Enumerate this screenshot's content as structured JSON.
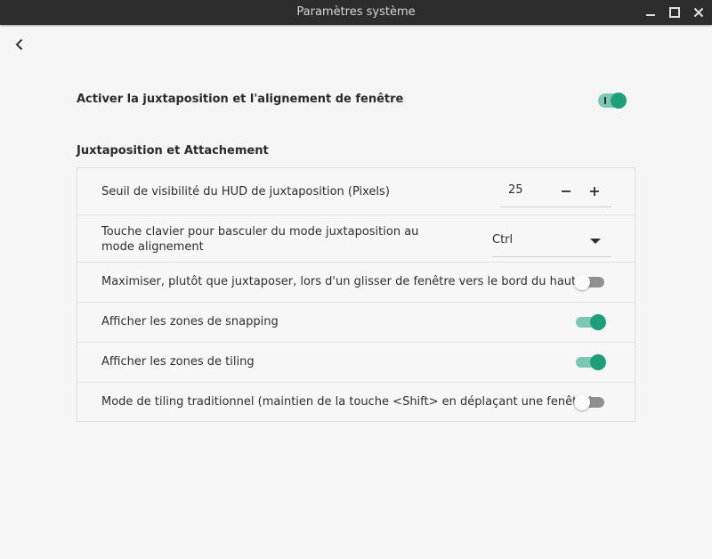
{
  "window": {
    "title": "Paramètres système"
  },
  "master": {
    "label": "Activer la juxtaposition et l'alignement de fenêtre",
    "enabled": true
  },
  "section": {
    "title": "Juxtaposition et Attachement"
  },
  "rows": {
    "hud_threshold": {
      "label": "Seuil de visibilité du HUD de juxtaposition (Pixels)",
      "value": "25",
      "minus": "−",
      "plus": "+"
    },
    "toggle_key": {
      "label": "Touche clavier pour basculer du mode juxtaposition au mode alignement",
      "value": "Ctrl"
    },
    "maximize": {
      "label": "Maximiser, plutôt que juxtaposer, lors d'un glisser de fenêtre vers le bord du haut",
      "enabled": false
    },
    "snap_zones": {
      "label": "Afficher les zones de snapping",
      "enabled": true
    },
    "tile_zones": {
      "label": "Afficher les zones de tiling",
      "enabled": true
    },
    "legacy": {
      "label": "Mode de tiling traditionnel (maintien de la touche <Shift> en déplaçant une fenêtre)",
      "enabled": false
    }
  },
  "colors": {
    "accent": "#1e9e7c",
    "accent_track": "#7cc7b3",
    "titlebar": "#2d2d2d",
    "background": "#f5f5f5"
  },
  "icons": [
    "minimize-icon",
    "maximize-icon",
    "close-icon",
    "back-arrow-icon",
    "minus-icon",
    "plus-icon",
    "dropdown-arrow-icon"
  ]
}
